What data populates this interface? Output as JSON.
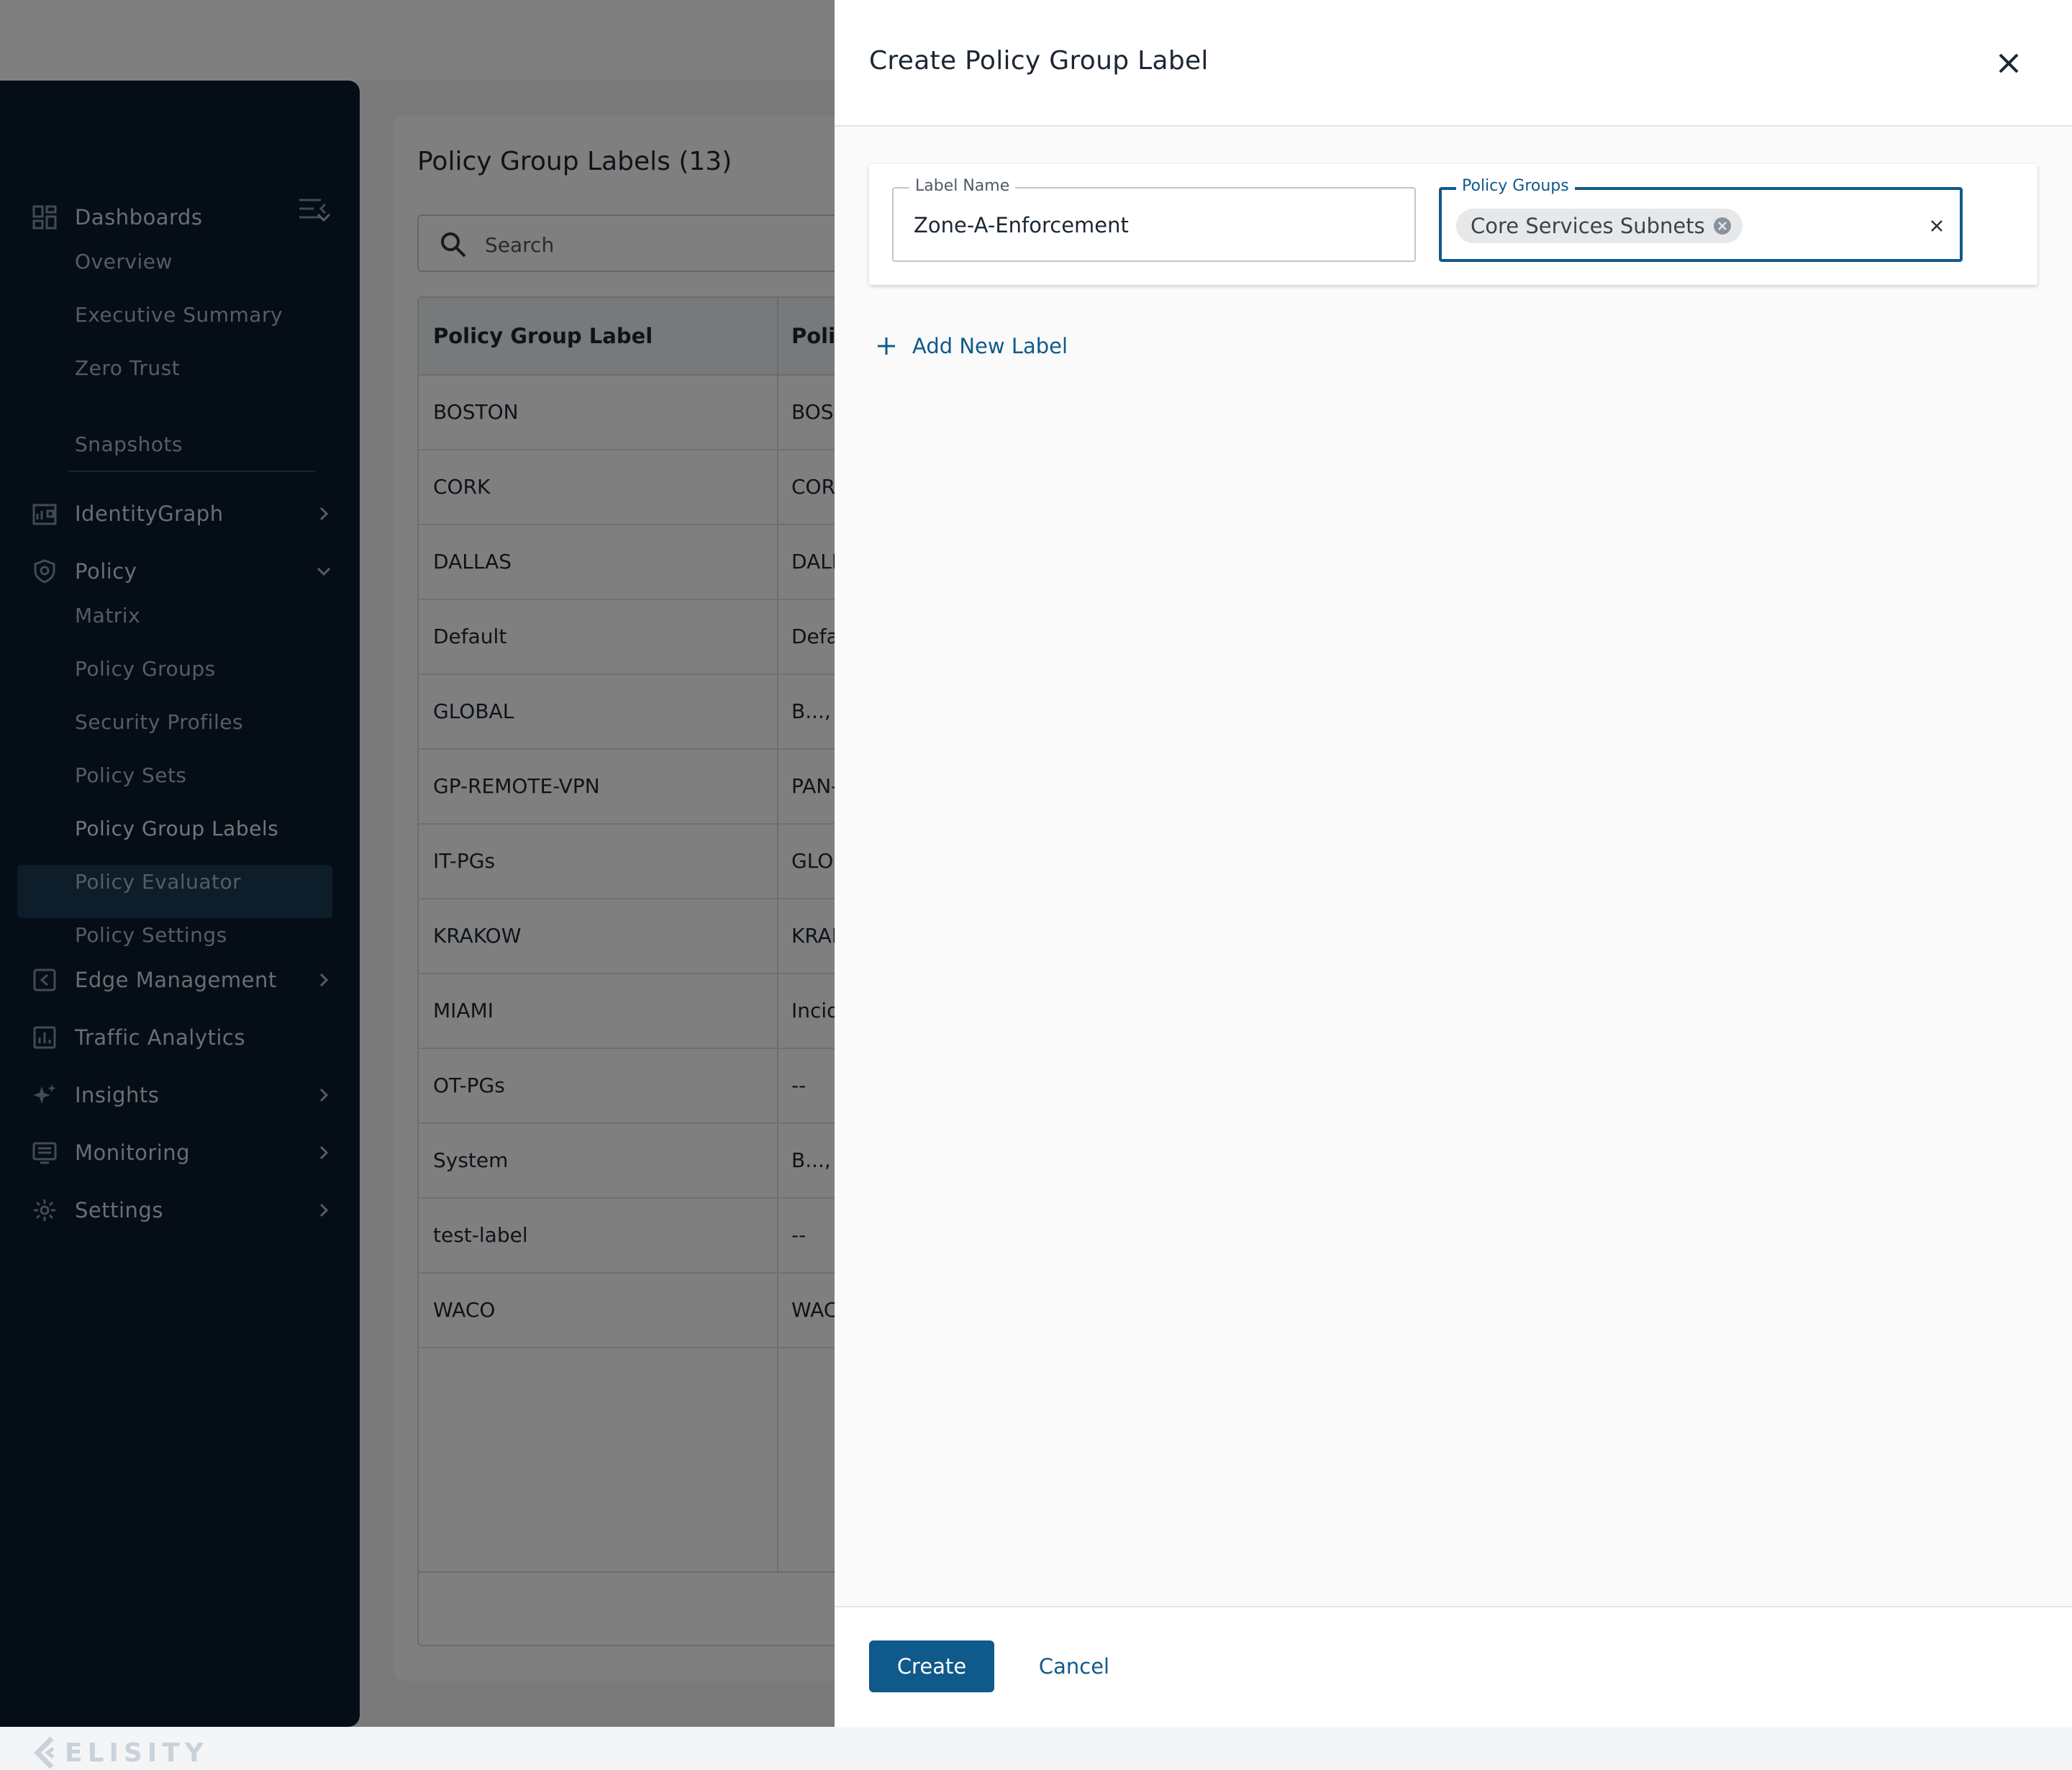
{
  "sidebar": {
    "brand": "ELISITY",
    "groups": {
      "dashboards": "Dashboards",
      "identitygraph": "IdentityGraph",
      "policy": "Policy",
      "edge_management": "Edge Management",
      "traffic_analytics": "Traffic Analytics",
      "insights": "Insights",
      "monitoring": "Monitoring",
      "settings": "Settings"
    },
    "dashboards_items": [
      "Overview",
      "Executive Summary",
      "Zero Trust",
      "Snapshots"
    ],
    "policy_items": [
      "Matrix",
      "Policy Groups",
      "Security Profiles",
      "Policy Sets",
      "Policy Group Labels",
      "Policy Evaluator",
      "Policy Settings"
    ],
    "active_item": "Policy Group Labels"
  },
  "main": {
    "title": "Policy Group Labels (13)",
    "search_placeholder": "Search",
    "columns": [
      "Policy Group Label",
      "Polic"
    ],
    "rows": [
      {
        "label": "BOSTON",
        "groups": "BOS"
      },
      {
        "label": "CORK",
        "groups": "COR"
      },
      {
        "label": "DALLAS",
        "groups": "DALL"
      },
      {
        "label": "Default",
        "groups": "Defa"
      },
      {
        "label": "GLOBAL",
        "groups": "B...,"
      },
      {
        "label": "GP-REMOTE-VPN",
        "groups": "PAN-"
      },
      {
        "label": "IT-PGs",
        "groups": "GLO"
      },
      {
        "label": "KRAKOW",
        "groups": "KRAK"
      },
      {
        "label": "MIAMI",
        "groups": "Incid"
      },
      {
        "label": "OT-PGs",
        "groups": "--"
      },
      {
        "label": "System",
        "groups": "B...,"
      },
      {
        "label": "test-label",
        "groups": "--"
      },
      {
        "label": "WACO",
        "groups": "WAC"
      }
    ]
  },
  "drawer": {
    "title": "Create Policy Group Label",
    "label_name_legend": "Label Name",
    "label_name_value": "Zone-A-Enforcement",
    "policy_groups_legend": "Policy Groups",
    "policy_group_chip": "Core Services Subnets",
    "add_new_label": "Add New Label",
    "create_label": "Create",
    "cancel_label": "Cancel"
  },
  "colors": {
    "accent": "#0f5a8a",
    "sidebar_bg": "#0a1d2e",
    "sidebar_active": "#1b3a55"
  }
}
